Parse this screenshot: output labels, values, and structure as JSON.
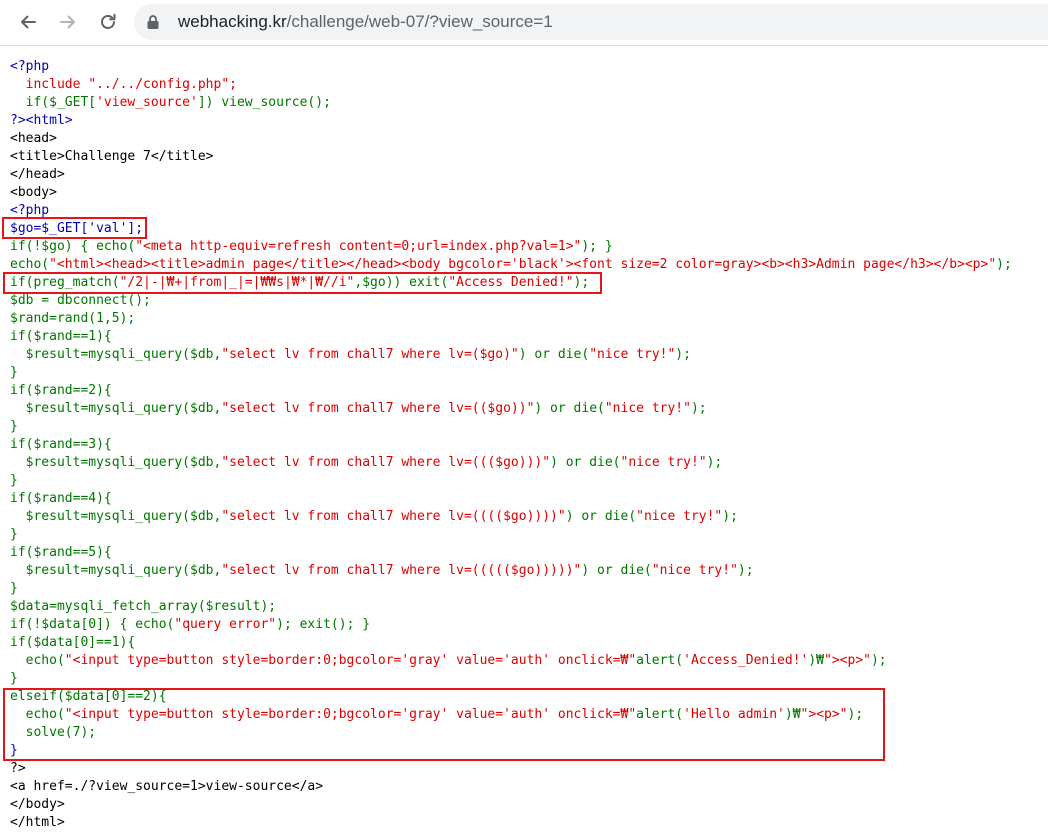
{
  "browser": {
    "url_domain": "webhacking.kr",
    "url_path": "/challenge/web-07/?view_source=1",
    "icons": [
      "back-arrow-icon",
      "forward-arrow-icon",
      "reload-icon",
      "lock-icon"
    ]
  },
  "source_lines": [
    "<?php",
    "  include \"../../config.php\";",
    "  if($_GET['view_source']) view_source();",
    "?><html>",
    "<head>",
    "<title>Challenge 7</title>",
    "</head>",
    "<body>",
    "<?php",
    "$go=$_GET['val'];",
    "if(!$go) { echo(\"<meta http-equiv=refresh content=0;url=index.php?val=1>\"); }",
    "echo(\"<html><head><title>admin page</title></head><body bgcolor='black'><font size=2 color=gray><b><h3>Admin page</h3></b><p>\");",
    "if(preg_match(\"/2|-|₩+|from|_|=|₩₩s|₩*|₩//i\",$go)) exit(\"Access Denied!\");",
    "$db = dbconnect();",
    "$rand=rand(1,5);",
    "if($rand==1){",
    "  $result=mysqli_query($db,\"select lv from chall7 where lv=($go)\") or die(\"nice try!\");",
    "}",
    "if($rand==2){",
    "  $result=mysqli_query($db,\"select lv from chall7 where lv=(($go))\") or die(\"nice try!\");",
    "}",
    "if($rand==3){",
    "  $result=mysqli_query($db,\"select lv from chall7 where lv=((($go)))\") or die(\"nice try!\");",
    "}",
    "if($rand==4){",
    "  $result=mysqli_query($db,\"select lv from chall7 where lv=(((($go))))\") or die(\"nice try!\");",
    "}",
    "if($rand==5){",
    "  $result=mysqli_query($db,\"select lv from chall7 where lv=((((($go)))))\") or die(\"nice try!\");",
    "}",
    "$data=mysqli_fetch_array($result);",
    "if(!$data[0]) { echo(\"query error\"); exit(); }",
    "if($data[0]==1){",
    "  echo(\"<input type=button style=border:0;bgcolor='gray' value='auth' onclick=₩\"alert('Access_Denied!')₩\"><p>\");",
    "}",
    "elseif($data[0]==2){",
    "  echo(\"<input type=button style=border:0;bgcolor='gray' value='auth' onclick=₩\"alert('Hello admin')₩\"><p>\");",
    "  solve(7);",
    "}",
    "?>",
    "<a href=./?view_source=1>view-source</a>",
    "</body>",
    "</html>"
  ],
  "line_colors": [
    "php",
    "red",
    "grn",
    "php",
    "html",
    "html",
    "html",
    "html",
    "php",
    "php",
    "grn",
    "grn",
    "grn",
    "grn",
    "grn",
    "grn",
    "grn",
    "grn",
    "grn",
    "grn",
    "grn",
    "grn",
    "grn",
    "grn",
    "grn",
    "grn",
    "grn",
    "grn",
    "grn",
    "grn",
    "grn",
    "grn",
    "grn",
    "grn",
    "grn",
    "grn",
    "grn",
    "grn",
    "php",
    "html",
    "html",
    "html"
  ],
  "colors": {
    "php_keyword": "#0000bb",
    "string": "#dd0000",
    "code": "#007700",
    "highlight_box": "#e8141a"
  }
}
